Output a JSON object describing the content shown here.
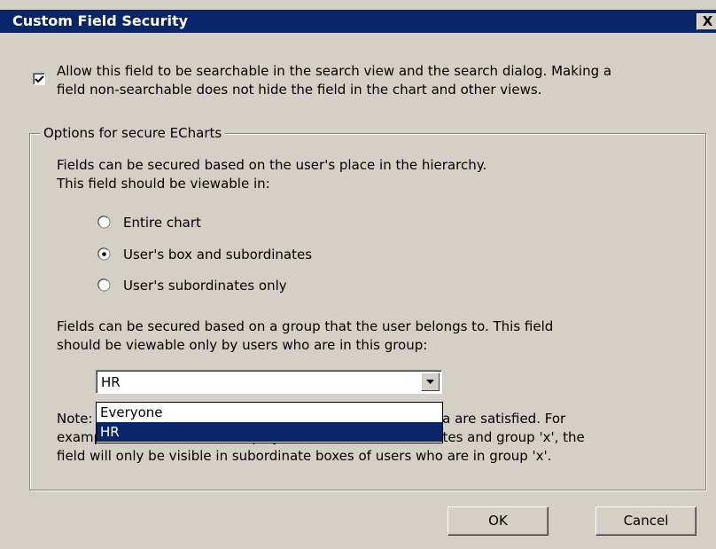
{
  "window": {
    "title": "Custom Field Security",
    "close_label": "X"
  },
  "searchable": {
    "checked": true,
    "label": "Allow this field to be searchable in the search view and the search dialog. Making a\nfield non-searchable does not hide the field in the chart and other views."
  },
  "group": {
    "title": "Options for secure ECharts",
    "hierarchy_text": "Fields can be secured based on the user's place in the hierarchy.\nThis field should be viewable in:",
    "options": [
      {
        "label": "Entire chart",
        "selected": false
      },
      {
        "label": "User's box and subordinates",
        "selected": true
      },
      {
        "label": "User's subordinates only",
        "selected": false
      }
    ],
    "group_text": "Fields can be secured based on a group that the user belongs to. This field\nshould be viewable only by users who are in this group:",
    "select_value": "HR",
    "dropdown_options": [
      "Everyone",
      "HR"
    ],
    "dropdown_selected": "HR",
    "note_text": "Note: this field will only display if both of the above criteria are satisfied. For\nexample if a field is set to display for the user's subordinates and group 'x', the\nfield will only be visible in subordinate boxes of users who are in group 'x'."
  },
  "buttons": {
    "ok": "OK",
    "cancel": "Cancel"
  }
}
